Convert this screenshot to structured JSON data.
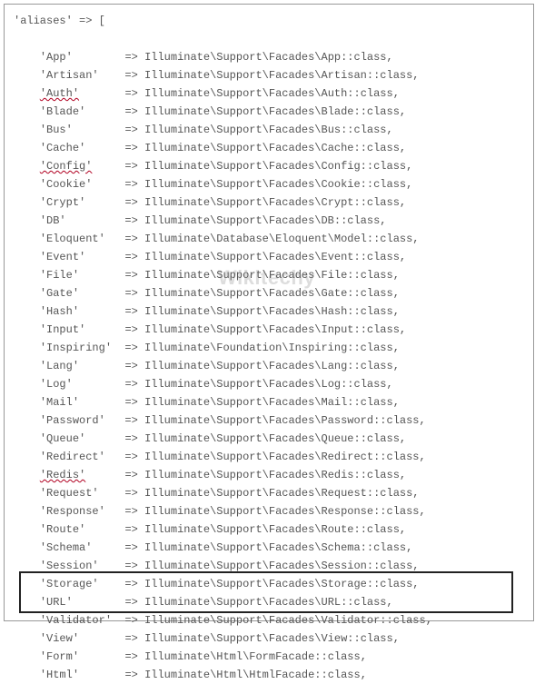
{
  "header": "'aliases' => [",
  "aliases": [
    {
      "key": "'App'",
      "pad": "       ",
      "arrow": " => ",
      "val": "Illuminate\\Support\\Facades\\App::class,",
      "squiggle": false
    },
    {
      "key": "'Artisan'",
      "pad": "   ",
      "arrow": " => ",
      "val": "Illuminate\\Support\\Facades\\Artisan::class,",
      "squiggle": false
    },
    {
      "key": "'Auth'",
      "pad": "      ",
      "arrow": " => ",
      "val": "Illuminate\\Support\\Facades\\Auth::class,",
      "squiggle": true
    },
    {
      "key": "'Blade'",
      "pad": "     ",
      "arrow": " => ",
      "val": "Illuminate\\Support\\Facades\\Blade::class,",
      "squiggle": false
    },
    {
      "key": "'Bus'",
      "pad": "       ",
      "arrow": " => ",
      "val": "Illuminate\\Support\\Facades\\Bus::class,",
      "squiggle": false
    },
    {
      "key": "'Cache'",
      "pad": "     ",
      "arrow": " => ",
      "val": "Illuminate\\Support\\Facades\\Cache::class,",
      "squiggle": false
    },
    {
      "key": "'Config'",
      "pad": "    ",
      "arrow": " => ",
      "val": "Illuminate\\Support\\Facades\\Config::class,",
      "squiggle": true
    },
    {
      "key": "'Cookie'",
      "pad": "    ",
      "arrow": " => ",
      "val": "Illuminate\\Support\\Facades\\Cookie::class,",
      "squiggle": false
    },
    {
      "key": "'Crypt'",
      "pad": "     ",
      "arrow": " => ",
      "val": "Illuminate\\Support\\Facades\\Crypt::class,",
      "squiggle": false
    },
    {
      "key": "'DB'",
      "pad": "        ",
      "arrow": " => ",
      "val": "Illuminate\\Support\\Facades\\DB::class,",
      "squiggle": false
    },
    {
      "key": "'Eloquent'",
      "pad": "  ",
      "arrow": " => ",
      "val": "Illuminate\\Database\\Eloquent\\Model::class,",
      "squiggle": false
    },
    {
      "key": "'Event'",
      "pad": "     ",
      "arrow": " => ",
      "val": "Illuminate\\Support\\Facades\\Event::class,",
      "squiggle": false
    },
    {
      "key": "'File'",
      "pad": "      ",
      "arrow": " => ",
      "val": "Illuminate\\Support\\Facades\\File::class,",
      "squiggle": false
    },
    {
      "key": "'Gate'",
      "pad": "      ",
      "arrow": " => ",
      "val": "Illuminate\\Support\\Facades\\Gate::class,",
      "squiggle": false
    },
    {
      "key": "'Hash'",
      "pad": "      ",
      "arrow": " => ",
      "val": "Illuminate\\Support\\Facades\\Hash::class,",
      "squiggle": false
    },
    {
      "key": "'Input'",
      "pad": "     ",
      "arrow": " => ",
      "val": "Illuminate\\Support\\Facades\\Input::class,",
      "squiggle": false
    },
    {
      "key": "'Inspiring'",
      "pad": " ",
      "arrow": " => ",
      "val": "Illuminate\\Foundation\\Inspiring::class,",
      "squiggle": false
    },
    {
      "key": "'Lang'",
      "pad": "      ",
      "arrow": " => ",
      "val": "Illuminate\\Support\\Facades\\Lang::class,",
      "squiggle": false
    },
    {
      "key": "'Log'",
      "pad": "       ",
      "arrow": " => ",
      "val": "Illuminate\\Support\\Facades\\Log::class,",
      "squiggle": false
    },
    {
      "key": "'Mail'",
      "pad": "      ",
      "arrow": " => ",
      "val": "Illuminate\\Support\\Facades\\Mail::class,",
      "squiggle": false
    },
    {
      "key": "'Password'",
      "pad": "  ",
      "arrow": " => ",
      "val": "Illuminate\\Support\\Facades\\Password::class,",
      "squiggle": false
    },
    {
      "key": "'Queue'",
      "pad": "     ",
      "arrow": " => ",
      "val": "Illuminate\\Support\\Facades\\Queue::class,",
      "squiggle": false
    },
    {
      "key": "'Redirect'",
      "pad": "  ",
      "arrow": " => ",
      "val": "Illuminate\\Support\\Facades\\Redirect::class,",
      "squiggle": false
    },
    {
      "key": "'Redis'",
      "pad": "     ",
      "arrow": " => ",
      "val": "Illuminate\\Support\\Facades\\Redis::class,",
      "squiggle": true
    },
    {
      "key": "'Request'",
      "pad": "   ",
      "arrow": " => ",
      "val": "Illuminate\\Support\\Facades\\Request::class,",
      "squiggle": false
    },
    {
      "key": "'Response'",
      "pad": "  ",
      "arrow": " => ",
      "val": "Illuminate\\Support\\Facades\\Response::class,",
      "squiggle": false
    },
    {
      "key": "'Route'",
      "pad": "     ",
      "arrow": " => ",
      "val": "Illuminate\\Support\\Facades\\Route::class,",
      "squiggle": false
    },
    {
      "key": "'Schema'",
      "pad": "    ",
      "arrow": " => ",
      "val": "Illuminate\\Support\\Facades\\Schema::class,",
      "squiggle": false
    },
    {
      "key": "'Session'",
      "pad": "   ",
      "arrow": " => ",
      "val": "Illuminate\\Support\\Facades\\Session::class,",
      "squiggle": false
    },
    {
      "key": "'Storage'",
      "pad": "   ",
      "arrow": " => ",
      "val": "Illuminate\\Support\\Facades\\Storage::class,",
      "squiggle": false
    },
    {
      "key": "'URL'",
      "pad": "       ",
      "arrow": " => ",
      "val": "Illuminate\\Support\\Facades\\URL::class,",
      "squiggle": false
    },
    {
      "key": "'Validator'",
      "pad": " ",
      "arrow": " => ",
      "val": "Illuminate\\Support\\Facades\\Validator::class,",
      "squiggle": false
    },
    {
      "key": "'View'",
      "pad": "      ",
      "arrow": " => ",
      "val": "Illuminate\\Support\\Facades\\View::class,",
      "squiggle": false
    },
    {
      "key": "'Form'",
      "pad": "      ",
      "arrow": " => ",
      "val": "Illuminate\\Html\\FormFacade::class,",
      "squiggle": false
    },
    {
      "key": "'Html'",
      "pad": "      ",
      "arrow": " => ",
      "val": "Illuminate\\Html\\HtmlFacade::class,",
      "squiggle": false
    }
  ],
  "indent_header": "",
  "indent_row": "    ",
  "watermark": "Wikitechy"
}
